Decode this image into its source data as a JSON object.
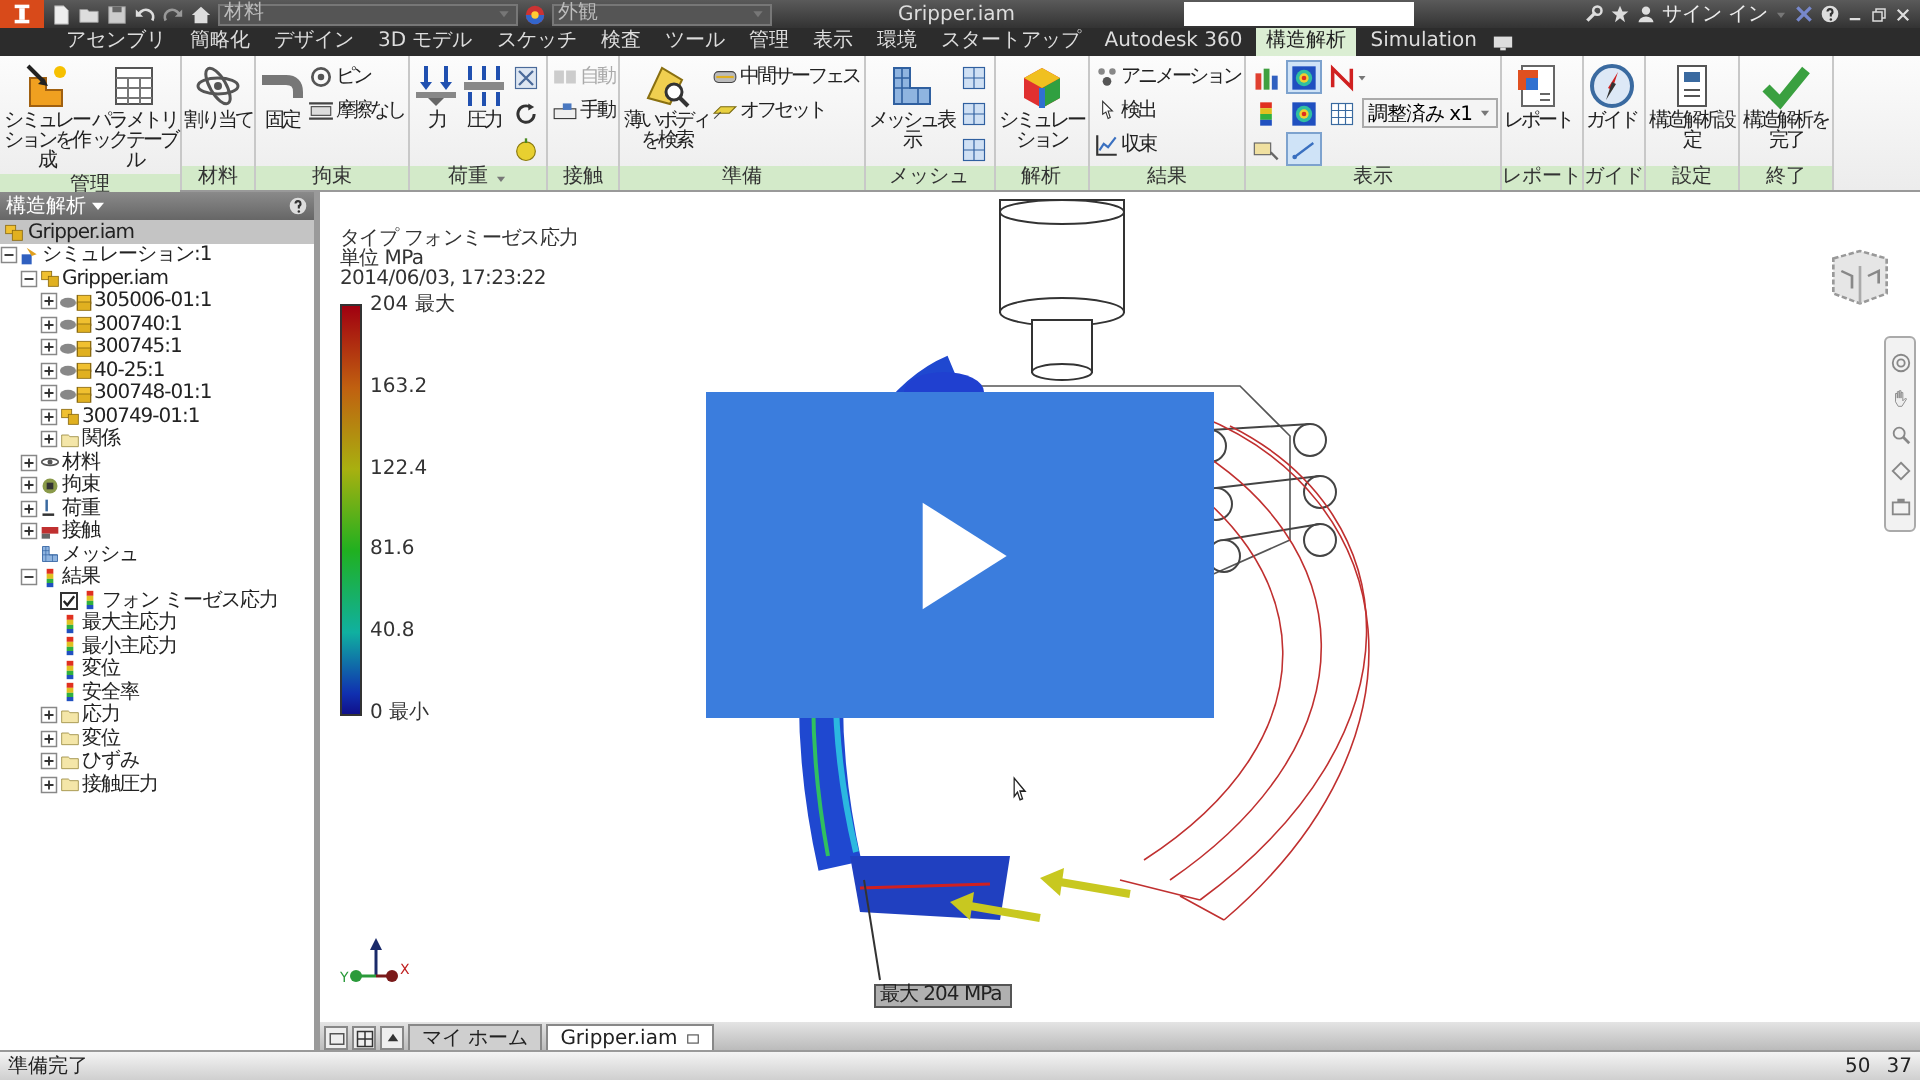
{
  "title_bar": {
    "material": "材料",
    "appearance": "外観",
    "title": "Gripper.iam",
    "sign_in": "サイン イン"
  },
  "menu_tabs": [
    {
      "label": "アセンブリ",
      "selected": false
    },
    {
      "label": "簡略化",
      "selected": false
    },
    {
      "label": "デザイン",
      "selected": false
    },
    {
      "label": "3D モデル",
      "selected": false
    },
    {
      "label": "スケッチ",
      "selected": false
    },
    {
      "label": "検査",
      "selected": false
    },
    {
      "label": "ツール",
      "selected": false
    },
    {
      "label": "管理",
      "selected": false
    },
    {
      "label": "表示",
      "selected": false
    },
    {
      "label": "環境",
      "selected": false
    },
    {
      "label": "スタートアップ",
      "selected": false
    },
    {
      "label": "Autodesk 360",
      "selected": false
    },
    {
      "label": "構造解析",
      "selected": true
    },
    {
      "label": "Simulation",
      "selected": false
    }
  ],
  "ribbon": {
    "panels": [
      {
        "label": "管理",
        "tools": [
          {
            "kind": "large",
            "label": "シミュレーションを作成"
          },
          {
            "kind": "large",
            "label": "パラメトリックテーブル"
          }
        ]
      },
      {
        "label": "材料",
        "tools": [
          {
            "kind": "large",
            "label": "割り当て"
          }
        ]
      },
      {
        "label": "拘束",
        "tools": [
          {
            "kind": "large",
            "label": "固定"
          },
          {
            "kind": "stack",
            "items": [
              {
                "kind": "small",
                "label": "ピン"
              },
              {
                "kind": "small",
                "label": "摩擦なし"
              }
            ]
          }
        ]
      },
      {
        "label": "荷重",
        "has_menu": true,
        "tools": [
          {
            "kind": "large",
            "label": "力"
          },
          {
            "kind": "large",
            "label": "圧力"
          },
          {
            "kind": "stack",
            "items": [
              {
                "kind": "icon"
              },
              {
                "kind": "icon"
              },
              {
                "kind": "icon"
              }
            ]
          }
        ]
      },
      {
        "label": "接触",
        "tools": [
          {
            "kind": "stack",
            "items": [
              {
                "kind": "small",
                "label": "自動",
                "disabled": true
              },
              {
                "kind": "small",
                "label": "手動",
                "disabled": false
              }
            ]
          }
        ]
      },
      {
        "label": "準備",
        "tools": [
          {
            "kind": "large",
            "label": "薄いボディを検索"
          },
          {
            "kind": "stack",
            "items": [
              {
                "kind": "small",
                "label": "中間サーフェス"
              },
              {
                "kind": "small",
                "label": "オフセット"
              }
            ]
          }
        ]
      },
      {
        "label": "メッシュ",
        "tools": [
          {
            "kind": "large",
            "label": "メッシュ表示"
          },
          {
            "kind": "stack",
            "items": [
              {
                "kind": "icon"
              },
              {
                "kind": "icon"
              },
              {
                "kind": "icon"
              }
            ]
          }
        ]
      },
      {
        "label": "解析",
        "tools": [
          {
            "kind": "large",
            "label": "シミュレーション"
          }
        ]
      },
      {
        "label": "結果",
        "tools": [
          {
            "kind": "stack",
            "items": [
              {
                "kind": "small",
                "label": "アニメーション"
              },
              {
                "kind": "small",
                "label": "検出"
              },
              {
                "kind": "small",
                "label": "収束"
              }
            ]
          }
        ]
      },
      {
        "label": "表示",
        "tools": [
          {
            "kind": "grid",
            "rows": [
              [
                {
                  "kind": "icon",
                  "selected": false
                },
                {
                  "kind": "icon",
                  "selected": true
                },
                {
                  "kind": "icon",
                  "selected": false,
                  "has_menu": true
                }
              ],
              [
                {
                  "kind": "icon",
                  "selected": false
                },
                {
                  "kind": "icon",
                  "selected": false
                },
                {
                  "kind": "icon",
                  "selected": false
                },
                {
                  "kind": "dropdown",
                  "value": "調整済み x1"
                }
              ],
              [
                {
                  "kind": "icon",
                  "selected": false
                },
                {
                  "kind": "icon",
                  "selected": true
                }
              ]
            ]
          }
        ]
      },
      {
        "label": "レポート",
        "tools": [
          {
            "kind": "large",
            "label": "レポート"
          }
        ]
      },
      {
        "label": "ガイド",
        "tools": [
          {
            "kind": "large",
            "label": "ガイド"
          }
        ]
      },
      {
        "label": "設定",
        "tools": [
          {
            "kind": "large",
            "label": "構造解析設定"
          }
        ]
      },
      {
        "label": "終了",
        "tools": [
          {
            "kind": "large",
            "label": "構造解析を完了"
          }
        ]
      }
    ]
  },
  "browser": {
    "title": "構造解析",
    "root": "Gripper.iam",
    "tree": [
      {
        "kind": "simulation",
        "label": "シミュレーション:1",
        "expanded": true,
        "children": [
          {
            "kind": "assembly",
            "label": "Gripper.iam",
            "expanded": true,
            "children": [
              {
                "kind": "component",
                "label": "305006-01:1",
                "expanded": false
              },
              {
                "kind": "component",
                "label": "300740:1",
                "expanded": false
              },
              {
                "kind": "component",
                "label": "300745:1",
                "expanded": false
              },
              {
                "kind": "component",
                "label": "40-25:1",
                "expanded": false
              },
              {
                "kind": "component",
                "label": "300748-01:1",
                "expanded": false
              },
              {
                "kind": "assembly",
                "label": "300749-01:1",
                "expanded": false
              },
              {
                "kind": "folder",
                "label": "関係",
                "expanded": false
              }
            ]
          },
          {
            "kind": "material",
            "label": "材料",
            "expanded": false
          },
          {
            "kind": "constraint",
            "label": "拘束",
            "expanded": false
          },
          {
            "kind": "load",
            "label": "荷重",
            "expanded": false
          },
          {
            "kind": "contact",
            "label": "接触",
            "expanded": false
          },
          {
            "kind": "mesh",
            "label": "メッシュ"
          },
          {
            "kind": "result",
            "label": "結果",
            "expanded": true,
            "children": [
              {
                "kind": "result",
                "label": "フォン ミーゼス応力",
                "checked": true
              },
              {
                "kind": "result",
                "label": "最大主応力"
              },
              {
                "kind": "result",
                "label": "最小主応力"
              },
              {
                "kind": "result",
                "label": "変位"
              },
              {
                "kind": "result",
                "label": "安全率"
              },
              {
                "kind": "folder",
                "label": "応力",
                "expanded": false
              },
              {
                "kind": "folder",
                "label": "変位",
                "expanded": false
              },
              {
                "kind": "folder",
                "label": "ひずみ",
                "expanded": false
              },
              {
                "kind": "folder",
                "label": "接触圧力",
                "expanded": false
              }
            ]
          }
        ]
      }
    ]
  },
  "viewport": {
    "legend": {
      "type": "タイプ フォンミーゼス応力",
      "unit": "単位 MPa",
      "timestamp": "2014/06/03, 17:23:22",
      "ticks": [
        "204 最大",
        "163.2",
        "122.4",
        "81.6",
        "40.8",
        "0 最小"
      ]
    },
    "probe_label": "最大 204 MPa",
    "triad": {
      "x": "X",
      "y": "Y"
    }
  },
  "document_tabs": [
    {
      "label": "マイ ホーム",
      "selected": false
    },
    {
      "label": "Gripper.iam",
      "selected": true
    }
  ],
  "status_bar": {
    "message": "準備完了",
    "values": [
      "50",
      "37"
    ]
  }
}
